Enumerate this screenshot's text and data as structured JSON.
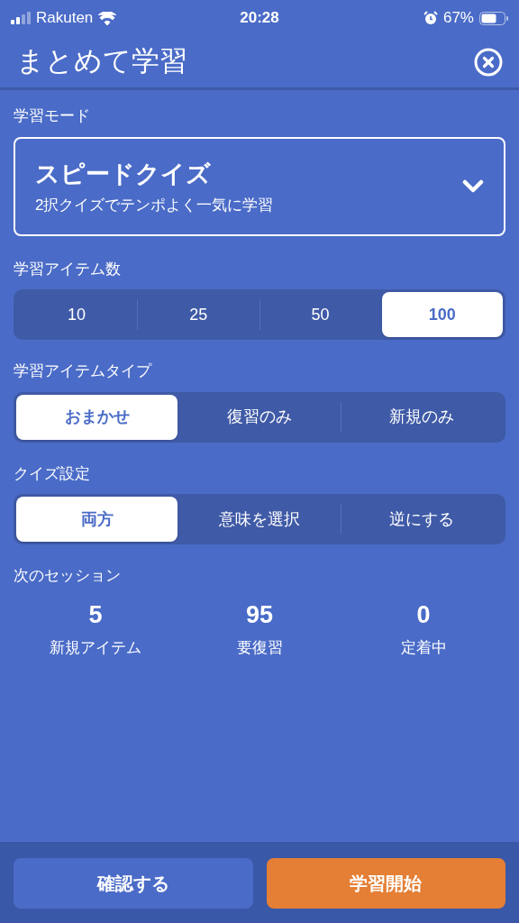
{
  "status_bar": {
    "carrier": "Rakuten",
    "time": "20:28",
    "battery": "67%"
  },
  "header": {
    "title": "まとめて学習"
  },
  "study_mode": {
    "label": "学習モード",
    "value": "スピードクイズ",
    "description": "2択クイズでテンポよく一気に学習"
  },
  "item_count": {
    "label": "学習アイテム数",
    "options": [
      {
        "label": "10",
        "selected": false
      },
      {
        "label": "25",
        "selected": false
      },
      {
        "label": "50",
        "selected": false
      },
      {
        "label": "100",
        "selected": true
      }
    ]
  },
  "item_type": {
    "label": "学習アイテムタイプ",
    "options": [
      {
        "label": "おまかせ",
        "selected": true
      },
      {
        "label": "復習のみ",
        "selected": false
      },
      {
        "label": "新規のみ",
        "selected": false
      }
    ]
  },
  "quiz_setting": {
    "label": "クイズ設定",
    "options": [
      {
        "label": "両方",
        "selected": true
      },
      {
        "label": "意味を選択",
        "selected": false
      },
      {
        "label": "逆にする",
        "selected": false
      }
    ]
  },
  "next_session": {
    "label": "次のセッション",
    "stats": [
      {
        "value": "5",
        "label": "新規アイテム"
      },
      {
        "value": "95",
        "label": "要復習"
      },
      {
        "value": "0",
        "label": "定着中"
      }
    ]
  },
  "buttons": [
    {
      "label": "確認する",
      "kind": "secondary"
    },
    {
      "label": "学習開始",
      "kind": "primary"
    }
  ]
}
